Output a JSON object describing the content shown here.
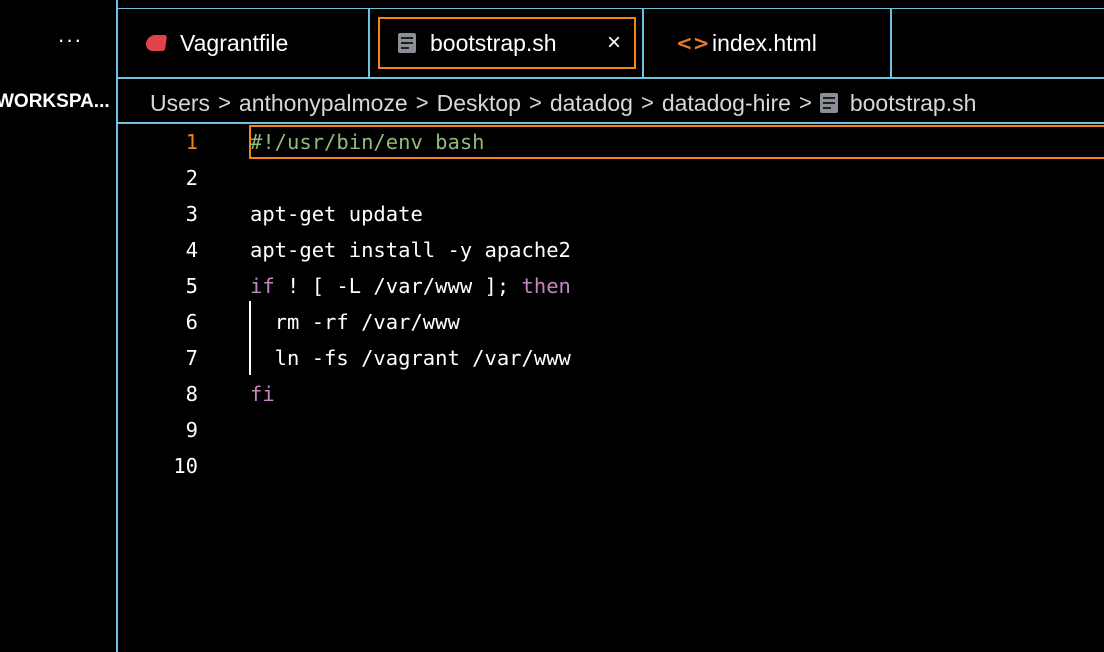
{
  "sidebar": {
    "more_label": "···",
    "title": "WORKSPA..."
  },
  "tabs": [
    {
      "label": "Vagrantfile",
      "icon": "ruby-icon"
    },
    {
      "label": "bootstrap.sh",
      "icon": "shell-file-icon",
      "active": true,
      "close": "×"
    },
    {
      "label": "index.html",
      "icon": "html-icon",
      "icon_glyph": "<>"
    }
  ],
  "breadcrumb": {
    "items": [
      "Users",
      "anthonypalmoze",
      "Desktop",
      "datadog",
      "datadog-hire",
      "bootstrap.sh"
    ],
    "separator": ">"
  },
  "editor": {
    "active_line": 1,
    "lines": [
      {
        "num": "1",
        "text": "#!/usr/bin/env bash"
      },
      {
        "num": "2",
        "text": ""
      },
      {
        "num": "3",
        "text": "apt-get update"
      },
      {
        "num": "4",
        "text": "apt-get install -y apache2"
      },
      {
        "num": "5",
        "kw1": "if",
        "mid": " ! [ -L /var/www ]; ",
        "kw2": "then"
      },
      {
        "num": "6",
        "text": "  rm -rf /var/www"
      },
      {
        "num": "7",
        "text": "  ln -fs /vagrant /var/www"
      },
      {
        "num": "8",
        "kw1": "fi"
      },
      {
        "num": "9",
        "text": ""
      },
      {
        "num": "10",
        "text": ""
      }
    ]
  },
  "colors": {
    "accent_border": "#6fc3df",
    "active_highlight": "#f38518",
    "comment": "#8fbc7a",
    "keyword": "#c586c0",
    "ruby_icon": "#e0434b",
    "html_icon": "#e37933"
  }
}
